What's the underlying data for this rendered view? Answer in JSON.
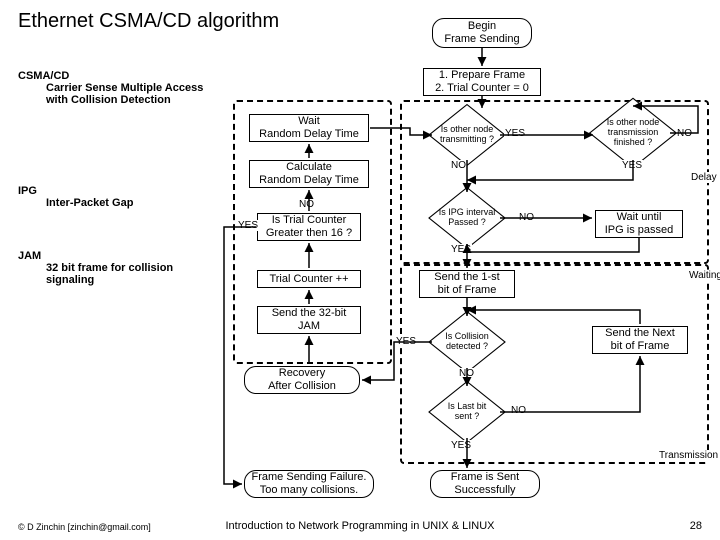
{
  "title": "Ethernet CSMA/CD algorithm",
  "defs": {
    "csma": {
      "term": "CSMA/CD",
      "desc": "Carrier Sense Multiple Access with Collision Detection"
    },
    "ipg": {
      "term": "IPG",
      "desc": "Inter-Packet Gap"
    },
    "jam": {
      "term": "JAM",
      "desc": "32 bit frame for collision signaling"
    }
  },
  "nodes": {
    "begin": "Begin\nFrame Sending",
    "prepare": "1. Prepare Frame\n2. Trial Counter = 0",
    "waitDelay": "Wait\nRandom Delay Time",
    "calcDelay": "Calculate\nRandom Delay Time",
    "trialCheck": "Is Trial Counter\nGreater then 16 ?",
    "incTrial": "Trial Counter ++",
    "sendJam": "Send the 32-bit\nJAM",
    "recovery": "Recovery\nAfter Collision",
    "failure": "Frame Sending Failure.\nToo many collisions.",
    "isTransmit": "Is other node\ntransmitting ?",
    "isFinished": "Is other node\ntransmission\nfinished ?",
    "ipgPassed": "Is IPG interval\nPassed ?",
    "waitIPG": "Wait until\nIPG is passed",
    "sendFirst": "Send the 1-st\nbit of Frame",
    "collision": "Is Collision\ndetected ?",
    "sendNext": "Send the Next\nbit of Frame",
    "lastBit": "Is Last bit\nsent ?",
    "success": "Frame is Sent\nSuccessfully"
  },
  "labels": {
    "yes": "YES",
    "no": "NO",
    "delay": "Delay",
    "waiting": "Waiting",
    "transmission": "Transmission"
  },
  "footer": {
    "left": "© D Zinchin [zinchin@gmail.com]",
    "center": "Introduction to Network Programming in UNIX & LINUX",
    "right": "28"
  }
}
